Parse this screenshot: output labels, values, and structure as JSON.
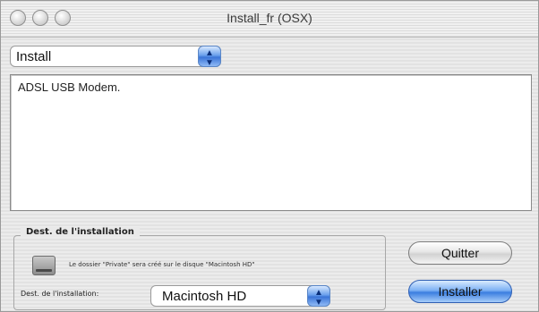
{
  "window": {
    "title": "Install_fr (OSX)"
  },
  "top_popup": {
    "value": "Install"
  },
  "textarea": {
    "text": "ADSL USB Modem."
  },
  "destination_group": {
    "title": "Dest. de l'installation",
    "note": "Le dossier \"Private\" sera créé sur le disque \"Macintosh HD\"",
    "label": "Dest. de l'installation:",
    "selected_disk": "Macintosh HD"
  },
  "buttons": {
    "quit": "Quitter",
    "install": "Installer"
  },
  "icons": {
    "popup_arrows": "updown-arrows-icon",
    "disk": "hard-disk-icon"
  },
  "colors": {
    "accent": "#3a74d8"
  }
}
